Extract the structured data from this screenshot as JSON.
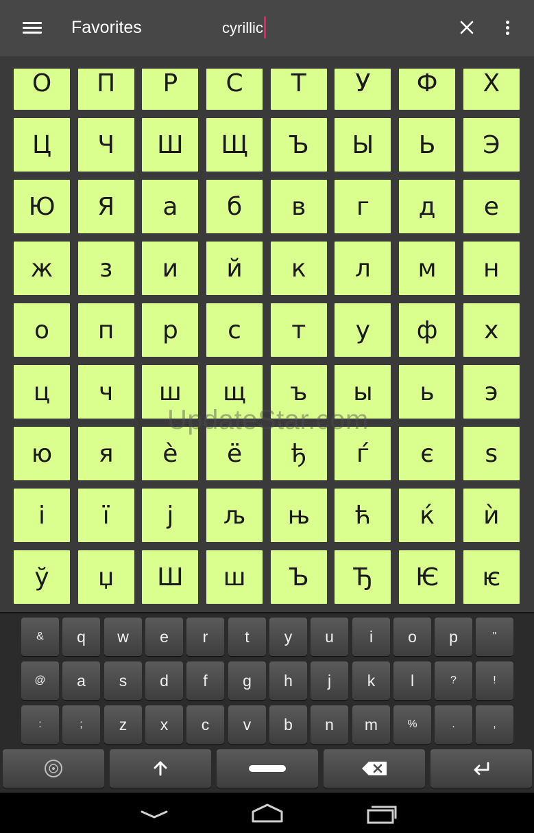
{
  "appbar": {
    "title": "Favorites",
    "search_value": "cyrillic",
    "icons": [
      "menu-icon",
      "search-cursor",
      "close-icon",
      "more-vert-icon"
    ]
  },
  "grid": {
    "cell_color": "#daff8e",
    "characters": [
      "О",
      "П",
      "Р",
      "С",
      "Т",
      "У",
      "Ф",
      "Х",
      "Ц",
      "Ч",
      "Ш",
      "Щ",
      "Ъ",
      "Ы",
      "Ь",
      "Э",
      "Ю",
      "Я",
      "а",
      "б",
      "в",
      "г",
      "д",
      "е",
      "ж",
      "з",
      "и",
      "й",
      "к",
      "л",
      "м",
      "н",
      "о",
      "п",
      "р",
      "с",
      "т",
      "у",
      "ф",
      "х",
      "ц",
      "ч",
      "ш",
      "щ",
      "ъ",
      "ы",
      "ь",
      "э",
      "ю",
      "я",
      "è",
      "ё",
      "ђ",
      "ѓ",
      "є",
      "ѕ",
      "і",
      "ї",
      "ј",
      "љ",
      "њ",
      "ћ",
      "ќ",
      "ѝ",
      "ў",
      "џ",
      "Ш",
      "ш",
      "Ъ",
      "Ђ",
      "Ѥ",
      "ѥ"
    ]
  },
  "watermark": "UpdateStar.com",
  "keyboard": {
    "row1": [
      "&",
      "q",
      "w",
      "e",
      "r",
      "t",
      "y",
      "u",
      "i",
      "o",
      "p",
      "\""
    ],
    "row2": [
      "@",
      "a",
      "s",
      "d",
      "f",
      "g",
      "h",
      "j",
      "k",
      "l",
      "?",
      "!"
    ],
    "row3": [
      ":",
      ";",
      "z",
      "x",
      "c",
      "v",
      "b",
      "n",
      "m",
      "%",
      ".",
      ","
    ],
    "bottom": [
      "symbols-key-icon",
      "shift-icon",
      "space-bar",
      "backspace-icon",
      "enter-icon"
    ]
  },
  "navbar": [
    "back-icon",
    "home-icon",
    "recents-icon"
  ]
}
